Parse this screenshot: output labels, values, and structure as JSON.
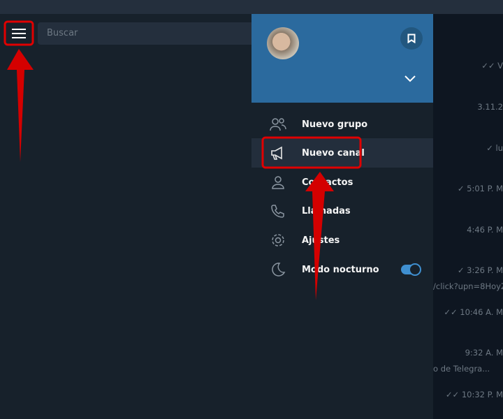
{
  "search": {
    "placeholder": "Buscar"
  },
  "drawer": {
    "items": [
      {
        "label": "Nuevo grupo",
        "icon": "group-icon"
      },
      {
        "label": "Nuevo canal",
        "icon": "megaphone-icon"
      },
      {
        "label": "Contactos",
        "icon": "person-icon"
      },
      {
        "label": "Llamadas",
        "icon": "phone-icon"
      },
      {
        "label": "Ajustes",
        "icon": "gear-icon"
      },
      {
        "label": "Modo nocturno",
        "icon": "moon-icon",
        "toggle_on": true
      }
    ]
  },
  "chats": {
    "times": [
      "✓✓ V",
      "3.11.2",
      "✓ lu",
      "✓ 5:01 P. M",
      "4:46 P. M",
      "✓ 3:26 P. M",
      "✓✓ 10:46 A. M",
      "9:32 A. M",
      "✓✓ 10:32 P. M"
    ],
    "snippets": [
      "/click?upn=8HoyZ.",
      "o de Telegra..."
    ]
  },
  "colors": {
    "accent": "#2b6a9e",
    "annotation": "#e00000"
  }
}
